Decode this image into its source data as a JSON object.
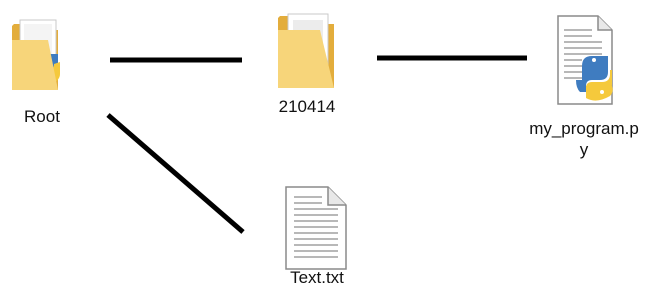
{
  "nodes": {
    "root": {
      "label": "Root",
      "icon": "folder-with-python-icon"
    },
    "folder": {
      "label": "210414",
      "icon": "folder-icon"
    },
    "py": {
      "label": "my_program.py",
      "icon": "python-file-icon"
    },
    "txt": {
      "label": "Text.txt",
      "icon": "text-file-icon"
    }
  },
  "edges": [
    {
      "from": "Root",
      "to": "210414"
    },
    {
      "from": "210414",
      "to": "my_program.py"
    },
    {
      "from": "Root",
      "to": "Text.txt"
    }
  ],
  "colors": {
    "edge": "#000000",
    "folder_back": "#e8b94a",
    "folder_front": "#f7d57a",
    "python_blue": "#3f7cc0",
    "python_yellow": "#f5c93c"
  }
}
